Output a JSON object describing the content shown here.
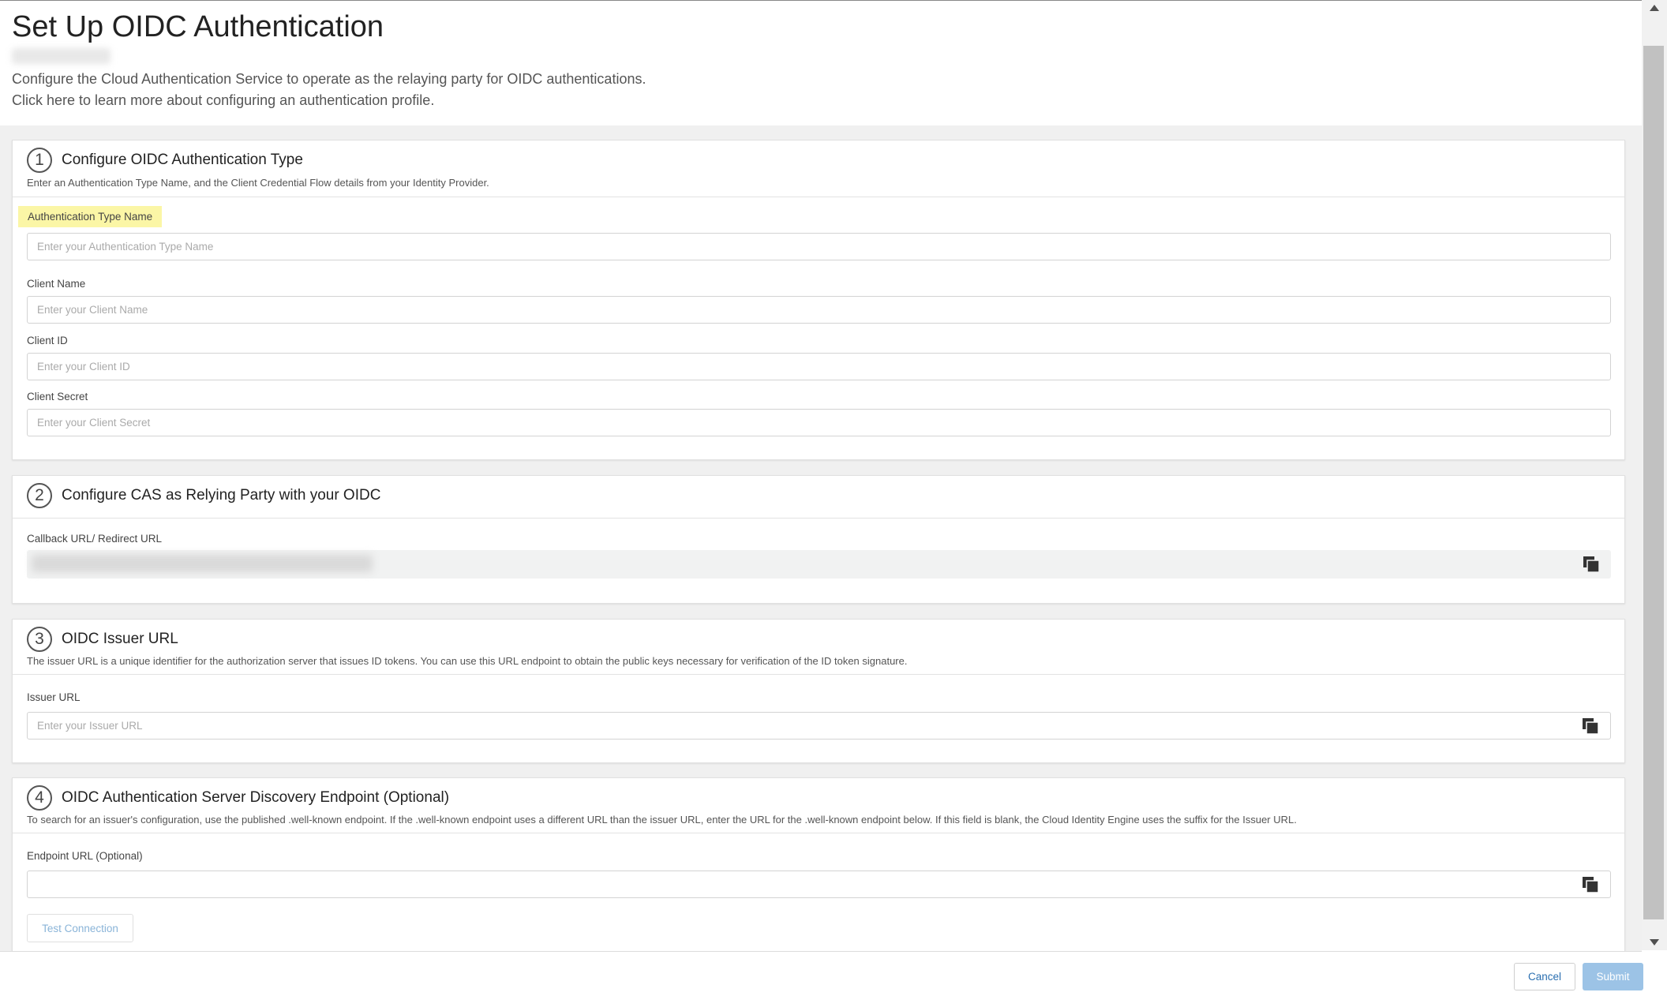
{
  "header": {
    "title": "Set Up OIDC Authentication",
    "description_line1": "Configure the Cloud Authentication Service to operate as the relaying party for OIDC authentications.",
    "description_line2": "Click here to learn more about configuring an authentication profile."
  },
  "sections": [
    {
      "number": "1",
      "title": "Configure OIDC Authentication Type",
      "description": "Enter an Authentication Type Name, and the Client Credential Flow details from your Identity Provider.",
      "fields": [
        {
          "label": "Authentication Type Name",
          "placeholder": "Enter your Authentication Type Name",
          "value": ""
        },
        {
          "label": "Client Name",
          "placeholder": "Enter your Client Name",
          "value": ""
        },
        {
          "label": "Client ID",
          "placeholder": "Enter your Client ID",
          "value": ""
        },
        {
          "label": "Client Secret",
          "placeholder": "Enter your Client Secret",
          "value": ""
        }
      ]
    },
    {
      "number": "2",
      "title": "Configure CAS as Relying Party with your OIDC",
      "fields": [
        {
          "label": "Callback URL/ Redirect URL"
        }
      ]
    },
    {
      "number": "3",
      "title": "OIDC Issuer URL",
      "description": "The issuer URL is a unique identifier for the authorization server that issues ID tokens. You can use this URL endpoint to obtain the public keys necessary for verification of the ID token signature.",
      "fields": [
        {
          "label": "Issuer URL",
          "placeholder": "Enter your Issuer URL",
          "value": ""
        }
      ]
    },
    {
      "number": "4",
      "title": "OIDC Authentication Server Discovery Endpoint (Optional)",
      "description": "To search for an issuer's configuration, use the published .well-known endpoint. If the .well-known endpoint uses a different URL than the issuer URL, enter the URL for the .well-known endpoint below. If this field is blank, the Cloud Identity Engine uses the suffix for the Issuer URL.",
      "fields": [
        {
          "label": "Endpoint URL (Optional)",
          "placeholder": "",
          "value": ""
        }
      ],
      "test_button": "Test Connection"
    }
  ],
  "footer": {
    "cancel": "Cancel",
    "submit": "Submit"
  },
  "colors": {
    "highlight": "#fbf6a6",
    "submit_bg": "#9cc3e6",
    "link_blue": "#2a6fb0"
  },
  "icons": {
    "copy": "copy-icon"
  }
}
